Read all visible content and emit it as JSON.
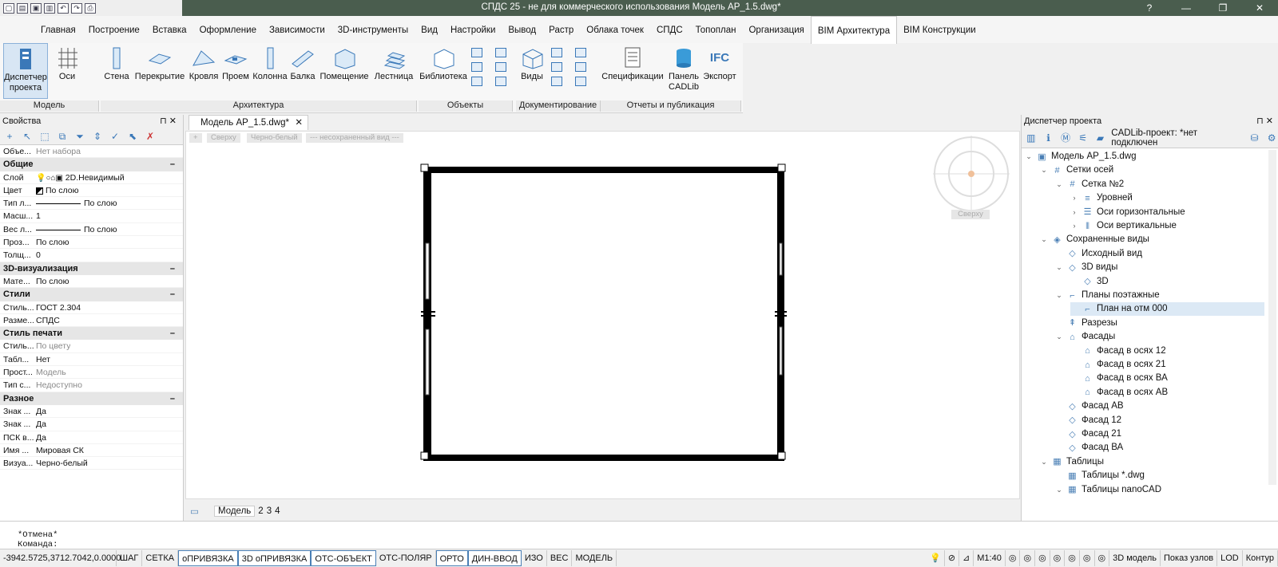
{
  "quick_access": [
    "new-icon",
    "open-icon",
    "save-icon",
    "saveas-icon",
    "undo-icon",
    "redo-icon",
    "print-icon"
  ],
  "window": {
    "title": "СПДС 25 - не для коммерческого использования Модель АР_1.5.dwg*",
    "help": "?"
  },
  "menu_tabs": [
    "Главная",
    "Построение",
    "Вставка",
    "Оформление",
    "Зависимости",
    "3D-инструменты",
    "Вид",
    "Настройки",
    "Вывод",
    "Растр",
    "Облака точек",
    "СПДС",
    "Топоплан",
    "Организация",
    "BIM Архитектура",
    "BIM Конструкции"
  ],
  "ribbon": {
    "model_buttons": [
      "Диспетчер проекта",
      "Оси"
    ],
    "arch_buttons": [
      "Стена",
      "Перекрытие",
      "Кровля",
      "Проем",
      "Колонна",
      "Балка",
      "Помещение",
      "Лестница"
    ],
    "objects_button": "Библиотека",
    "doc_button": "Виды",
    "reports_buttons": [
      "Спецификации",
      "Панель CADLib",
      "Экспорт"
    ],
    "ifc_label": "IFC",
    "groups": [
      "Модель",
      "Архитектура",
      "Объекты",
      "Документирование",
      "Отчеты и публикация"
    ]
  },
  "properties": {
    "title": "Свойства",
    "top": {
      "k": "Объе...",
      "v": "Нет набора"
    },
    "groups": [
      {
        "name": "Общие",
        "rows": [
          [
            "Слой",
            "2D.Невидимый"
          ],
          [
            "Цвет",
            "По слою"
          ],
          [
            "Тип л...",
            "По слою"
          ],
          [
            "Масш...",
            "1"
          ],
          [
            "Вес л...",
            "По слою"
          ],
          [
            "Проз...",
            "По слою"
          ],
          [
            "Толщ...",
            "0"
          ]
        ]
      },
      {
        "name": "3D-визуализация",
        "rows": [
          [
            "Мате...",
            "По слою"
          ]
        ]
      },
      {
        "name": "Стили",
        "rows": [
          [
            "Стиль...",
            "ГОСТ 2.304"
          ],
          [
            "Разме...",
            "СПДС"
          ]
        ]
      },
      {
        "name": "Стиль печати",
        "rows": [
          [
            "Стиль...",
            "По цвету"
          ],
          [
            "Табл...",
            "Нет"
          ],
          [
            "Прост...",
            "Модель"
          ],
          [
            "Тип с...",
            "Недоступно"
          ]
        ]
      },
      {
        "name": "Разное",
        "rows": [
          [
            "Знак ...",
            "Да"
          ],
          [
            "Знак ...",
            "Да"
          ],
          [
            "ПСК в...",
            "Да"
          ],
          [
            "Имя ...",
            "Мировая СК"
          ],
          [
            "Визуа...",
            "Черно-белый"
          ]
        ]
      }
    ]
  },
  "document": {
    "tab": "Модель АР_1.5.dwg*",
    "view_chips": [
      "+",
      "Сверху",
      "Черно-белый",
      "--- несохраненный вид ---"
    ],
    "viewcube_label": "Сверху",
    "layout_tabs": [
      "Модель",
      "2",
      "3",
      "4"
    ]
  },
  "project_manager": {
    "title": "Диспетчер проекта",
    "cadlib": "CADLib-проект: *нет подключен",
    "tree": [
      {
        "label": "Модель АР_1.5.dwg",
        "level": 0,
        "tw": "⌄",
        "icon": "dwg-file-icon",
        "glyph": "▣"
      },
      {
        "label": "Сетки осей",
        "level": 1,
        "tw": "⌄",
        "icon": "grid-icon",
        "glyph": "#"
      },
      {
        "label": "Сетка №2",
        "level": 2,
        "tw": "⌄",
        "icon": "grid-icon",
        "glyph": "#"
      },
      {
        "label": "Уровней",
        "level": 3,
        "tw": "›",
        "icon": "levels-icon",
        "glyph": "≡"
      },
      {
        "label": "Оси горизонтальные",
        "level": 3,
        "tw": "›",
        "icon": "axis-h-icon",
        "glyph": "☰"
      },
      {
        "label": "Оси вертикальные",
        "level": 3,
        "tw": "›",
        "icon": "axis-v-icon",
        "glyph": "⦀"
      },
      {
        "label": "Сохраненные виды",
        "level": 1,
        "tw": "⌄",
        "icon": "saved-views-icon",
        "glyph": "◈"
      },
      {
        "label": "Исходный вид",
        "level": 2,
        "tw": "",
        "icon": "view-cube-icon",
        "glyph": "◇"
      },
      {
        "label": "3D виды",
        "level": 2,
        "tw": "⌄",
        "icon": "view-3d-icon",
        "glyph": "◇"
      },
      {
        "label": "3D",
        "level": 3,
        "tw": "",
        "icon": "cube-icon",
        "glyph": "◇"
      },
      {
        "label": "Планы поэтажные",
        "level": 2,
        "tw": "⌄",
        "icon": "plan-icon",
        "glyph": "⌐"
      },
      {
        "label": "План на отм 000",
        "level": 3,
        "tw": "",
        "icon": "plan-icon",
        "glyph": "⌐",
        "hl": true
      },
      {
        "label": "Разрезы",
        "level": 2,
        "tw": "",
        "icon": "section-icon",
        "glyph": "⇞"
      },
      {
        "label": "Фасады",
        "level": 2,
        "tw": "⌄",
        "icon": "facade-icon",
        "glyph": "⌂"
      },
      {
        "label": "Фасад в осях 12",
        "level": 3,
        "tw": "",
        "icon": "facade-icon",
        "glyph": "⌂"
      },
      {
        "label": "Фасад в осях 21",
        "level": 3,
        "tw": "",
        "icon": "facade-icon",
        "glyph": "⌂"
      },
      {
        "label": "Фасад в осях ВА",
        "level": 3,
        "tw": "",
        "icon": "facade-icon",
        "glyph": "⌂"
      },
      {
        "label": "Фасад в осях АВ",
        "level": 3,
        "tw": "",
        "icon": "facade-icon",
        "glyph": "⌂"
      },
      {
        "label": "Фасад АВ",
        "level": 2,
        "tw": "",
        "icon": "cube-icon",
        "glyph": "◇"
      },
      {
        "label": "Фасад 12",
        "level": 2,
        "tw": "",
        "icon": "cube-icon",
        "glyph": "◇"
      },
      {
        "label": "Фасад 21",
        "level": 2,
        "tw": "",
        "icon": "cube-icon",
        "glyph": "◇"
      },
      {
        "label": "Фасад ВА",
        "level": 2,
        "tw": "",
        "icon": "cube-icon",
        "glyph": "◇"
      },
      {
        "label": "Таблицы",
        "level": 1,
        "tw": "⌄",
        "icon": "table-icon",
        "glyph": "▦"
      },
      {
        "label": "Таблицы *.dwg",
        "level": 2,
        "tw": "",
        "icon": "table-dwg-icon",
        "glyph": "▦"
      },
      {
        "label": "Таблицы nanoCAD",
        "level": 2,
        "tw": "⌄",
        "icon": "table-icon",
        "glyph": "▦"
      }
    ]
  },
  "command": {
    "line2": "*Отмена*",
    "prompt": "Команда:"
  },
  "statusbar": {
    "coords": "-3942.5725,3712.7042,0.0000",
    "buttons": [
      "ШАГ",
      "СЕТКА",
      "оПРИВЯЗКА",
      "3D оПРИВЯЗКА",
      "ОТС-ОБЪЕКТ",
      "ОТС-ПОЛЯР",
      "ОРТО",
      "ДИН-ВВОД",
      "ИЗО",
      "ВЕС",
      "МОДЕЛЬ"
    ],
    "on": [
      2,
      3,
      4,
      6,
      7
    ],
    "scale": "М1:40",
    "right": [
      "3D модель",
      "Показ узлов",
      "LOD",
      "Контур"
    ]
  },
  "colors": {
    "titlebar": "#4a5d4e",
    "accent": "#4a7fb5",
    "highlight": "#dce9f5"
  }
}
